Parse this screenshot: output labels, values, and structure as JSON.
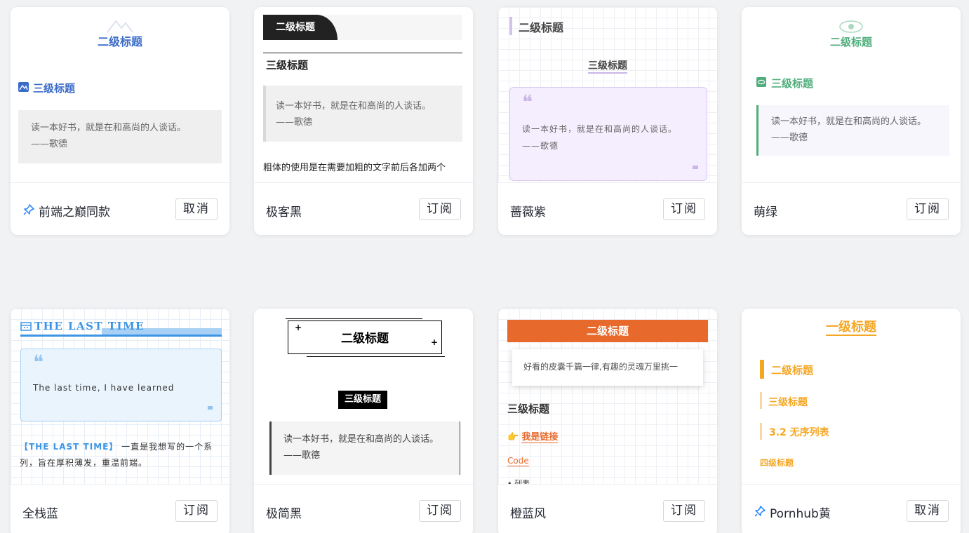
{
  "cards": [
    {
      "name": "前端之巅同款",
      "action": "取消",
      "pinned": true,
      "preview": {
        "h2": "二级标题",
        "h3": "三级标题",
        "quote": "读一本好书，就是在和高尚的人谈话。",
        "quote_author": "——歌德"
      }
    },
    {
      "name": "极客黑",
      "action": "订阅",
      "pinned": false,
      "preview": {
        "h2": "二级标题",
        "h3": "三级标题",
        "quote": "读一本好书，就是在和高尚的人谈话。",
        "quote_author": "——歌德",
        "para": "粗体的使用是在需要加粗的文字前后各加两个"
      }
    },
    {
      "name": "蔷薇紫",
      "action": "订阅",
      "pinned": false,
      "preview": {
        "h2": "二级标题",
        "h3": "三级标题",
        "quote_mark": "❝",
        "quote": "读一本好书，就是在和高尚的人谈话。",
        "quote_author": "——歌德"
      }
    },
    {
      "name": "萌绿",
      "action": "订阅",
      "pinned": false,
      "preview": {
        "h2": "二级标题",
        "h3": "三级标题",
        "quote": "读一本好书，就是在和高尚的人谈话。",
        "quote_author": "——歌德"
      }
    },
    {
      "name": "全栈蓝",
      "action": "订阅",
      "pinned": false,
      "preview": {
        "h2": "THE LAST TIME",
        "quote_mark": "❝",
        "quote": "The last time, I have learned",
        "tag": "【THE LAST TIME】",
        "para": "一直是我想写的一个系列，旨在厚积薄发，重温前端。"
      }
    },
    {
      "name": "极简黑",
      "action": "订阅",
      "pinned": false,
      "preview": {
        "h2": "二级标题",
        "h3": "三级标题",
        "quote": "读一本好书，就是在和高尚的人谈话。——歌德"
      }
    },
    {
      "name": "橙蓝风",
      "action": "订阅",
      "pinned": false,
      "preview": {
        "h2": "二级标题",
        "quote": "好看的皮囊千篇一律,有趣的灵魂万里挑一",
        "h3": "三级标题",
        "link": "我是链接",
        "code": "Code",
        "list": "列表"
      }
    },
    {
      "name": "Pornhub黄",
      "action": "取消",
      "pinned": true,
      "preview": {
        "h1": "一级标题",
        "h2": "二级标题",
        "h3": "三级标题",
        "h3b": "3.2 无序列表",
        "h4": "四级标题"
      }
    }
  ],
  "colors": {
    "blue": "#3a6cc9",
    "green": "#4fae7b",
    "purple": "#b89bd9",
    "orange": "#e8692c",
    "yellow": "#f5a623",
    "fullstack_blue": "#3d95e6"
  },
  "icons": {
    "pin": "pin-icon",
    "mountain": "mountain-icon",
    "eye": "eye-icon",
    "calendar": "calendar-icon",
    "hand": "pointing-hand-icon"
  }
}
